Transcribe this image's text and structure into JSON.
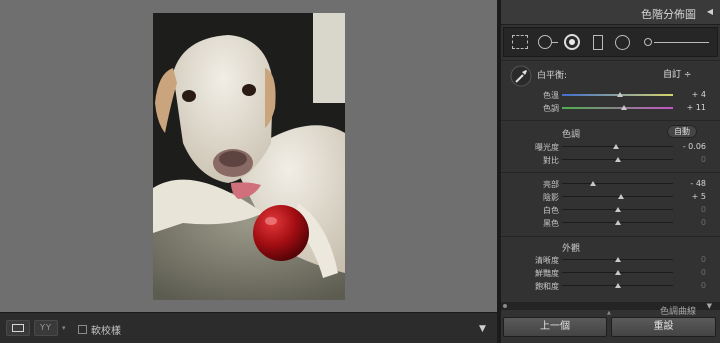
{
  "toolbar": {
    "yy_label": "YY",
    "softproof_label": "軟校樣",
    "softproof_checked": false
  },
  "panel": {
    "header_title": "色階分佈圖",
    "white_balance": {
      "label": "白平衡:",
      "selected": "自訂 ÷",
      "sliders": [
        {
          "label": "色溫",
          "value": "+ 4",
          "level": 0.52
        },
        {
          "label": "色調",
          "value": "+ 11",
          "level": 0.56
        }
      ]
    },
    "tone": {
      "title": "色調",
      "auto_label": "自動",
      "sliders": [
        {
          "label": "曝光度",
          "value": "- 0.06",
          "level": 0.49
        },
        {
          "label": "對比",
          "value": "0",
          "level": 0.5
        }
      ]
    },
    "tone2": {
      "sliders": [
        {
          "label": "亮部",
          "value": "- 48",
          "level": 0.28
        },
        {
          "label": "陰影",
          "value": "+ 5",
          "level": 0.53
        },
        {
          "label": "白色",
          "value": "0",
          "level": 0.5
        },
        {
          "label": "黑色",
          "value": "0",
          "level": 0.5
        }
      ]
    },
    "presence": {
      "title": "外觀",
      "sliders": [
        {
          "label": "清晰度",
          "value": "0",
          "level": 0.5
        },
        {
          "label": "鮮豔度",
          "value": "0",
          "level": 0.5
        },
        {
          "label": "飽和度",
          "value": "0",
          "level": 0.5
        }
      ]
    },
    "next_section": "色調曲線",
    "prev_button": "上一個",
    "reset_button": "重設"
  },
  "colors": {
    "temp_gradient": [
      "#3f6fd0",
      "#d8d46a"
    ],
    "tint_gradient": [
      "#4fb04f",
      "#c455c4"
    ]
  }
}
